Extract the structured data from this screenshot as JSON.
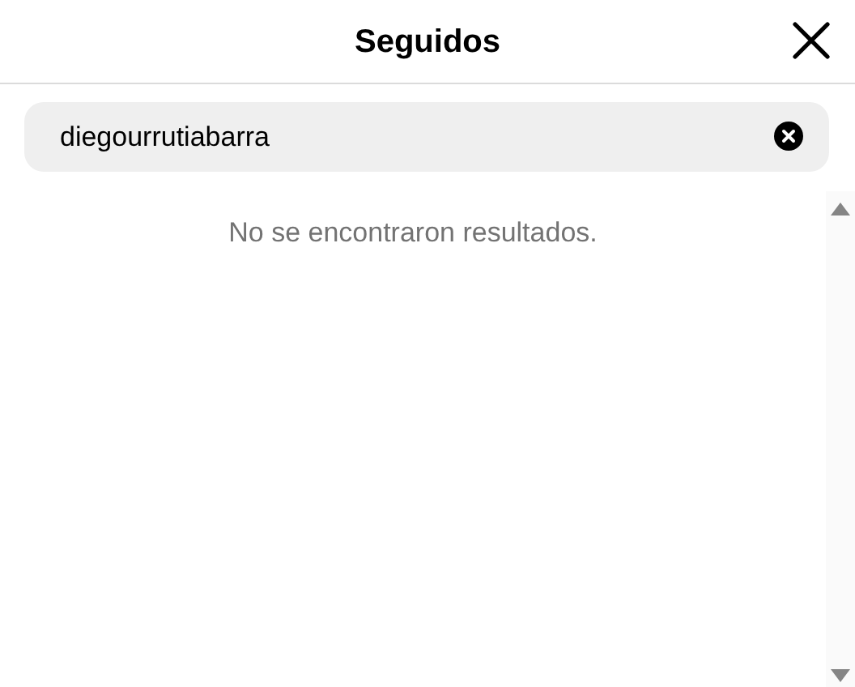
{
  "dialog": {
    "title": "Seguidos"
  },
  "search": {
    "value": "diegourrutiabarra"
  },
  "results": {
    "empty_message": "No se encontraron resultados."
  }
}
